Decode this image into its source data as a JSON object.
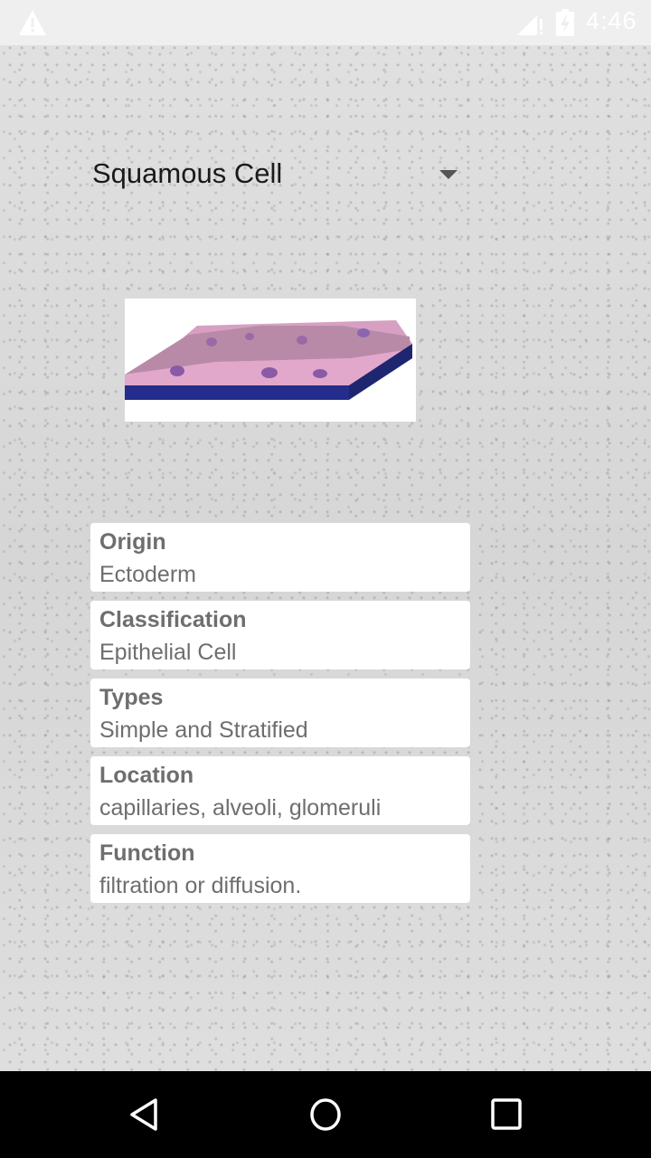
{
  "status_bar": {
    "time": "4:46",
    "icons": [
      "warning-icon",
      "signal-no-data-icon",
      "battery-charging-icon"
    ]
  },
  "spinner": {
    "selected": "Squamous Cell"
  },
  "image": {
    "alt": "Squamous epithelial cell layer illustration"
  },
  "cards": [
    {
      "title": "Origin",
      "value": "Ectoderm"
    },
    {
      "title": "Classification",
      "value": "Epithelial Cell"
    },
    {
      "title": "Types",
      "value": "Simple and Stratified"
    },
    {
      "title": "Location",
      "value": "capillaries, alveoli, glomeruli"
    },
    {
      "title": "Function",
      "value": "filtration or diffusion."
    }
  ],
  "nav_bar": {
    "buttons": [
      "back",
      "home",
      "recents"
    ]
  }
}
